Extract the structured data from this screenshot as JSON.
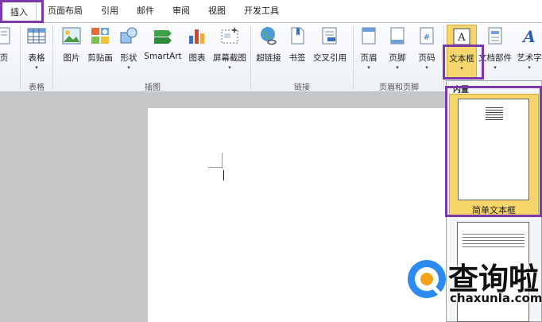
{
  "tabs": [
    "插入",
    "页面布局",
    "引用",
    "邮件",
    "审阅",
    "视图",
    "开发工具"
  ],
  "ribbon": {
    "page": "页",
    "table": "表格",
    "picture": "图片",
    "clipart": "剪贴画",
    "shapes": "形状",
    "smartart": "SmartArt",
    "chart": "图表",
    "screenshot": "屏幕截图",
    "hyperlink": "超链接",
    "bookmark": "书签",
    "crossref": "交叉引用",
    "header": "页眉",
    "footer": "页脚",
    "pagenumber": "页码",
    "textbox": "文本框",
    "docparts": "文档部件",
    "wordart": "艺术字",
    "caret": "▾"
  },
  "groups": {
    "tables": "表格",
    "illustrations": "插图",
    "links": "链接",
    "headerfooter": "页眉和页脚"
  },
  "gallery": {
    "section": "内置",
    "item1": "简单文本框"
  },
  "watermark": {
    "name": "查询啦",
    "url": "chaxunla.com"
  },
  "colors": {
    "highlight": "#7a38a8",
    "textbox_active": "#f6d66f",
    "selected_item": "#f8d56a",
    "logo_blue": "#2c8bf0",
    "logo_orange": "#f5a21b"
  }
}
